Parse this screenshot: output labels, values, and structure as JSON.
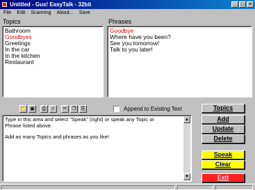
{
  "window": {
    "title": "Untitled - Gus! EasyTalk - 32bit",
    "controls": [
      "_",
      "□",
      "×"
    ]
  },
  "menu": [
    "File",
    "Edit",
    "Scanning",
    "About...",
    "Save"
  ],
  "topics": {
    "label": "Topics",
    "items": [
      "Bathroom",
      "Goodbyes",
      "Greetings",
      "In the car",
      "In the kitchen",
      "Restaurant"
    ],
    "selected_index": 1
  },
  "phrases": {
    "label": "Phrases",
    "items": [
      "Goodbye",
      "Where have you been?",
      "See you tomorrow!",
      "Talk to you later!"
    ],
    "selected_index": 0
  },
  "toolbar": {
    "icons": [
      "open-folder-icon",
      "save-disk-icon",
      "print-icon",
      "spell-check-icon",
      "cut-icon",
      "copy-icon",
      "paste-icon"
    ]
  },
  "append": {
    "label": "Append to Existing Text",
    "checked": false
  },
  "editor": {
    "paragraphs": [
      "Type in this area and select \"Speak\" (right) or speak any Topic or Phrase listed above.",
      "Add as many Topics and phrases as you like!"
    ]
  },
  "buttons": {
    "topics": "Topics",
    "add": "Add",
    "update": "Update",
    "delete": "Delete",
    "speak": "Speak",
    "clear": "Clear",
    "exit": "Exit"
  },
  "colors": {
    "selected_text": "#e00000",
    "speak_clear_bg": "#ffff00",
    "exit_bg": "#ff2020"
  }
}
